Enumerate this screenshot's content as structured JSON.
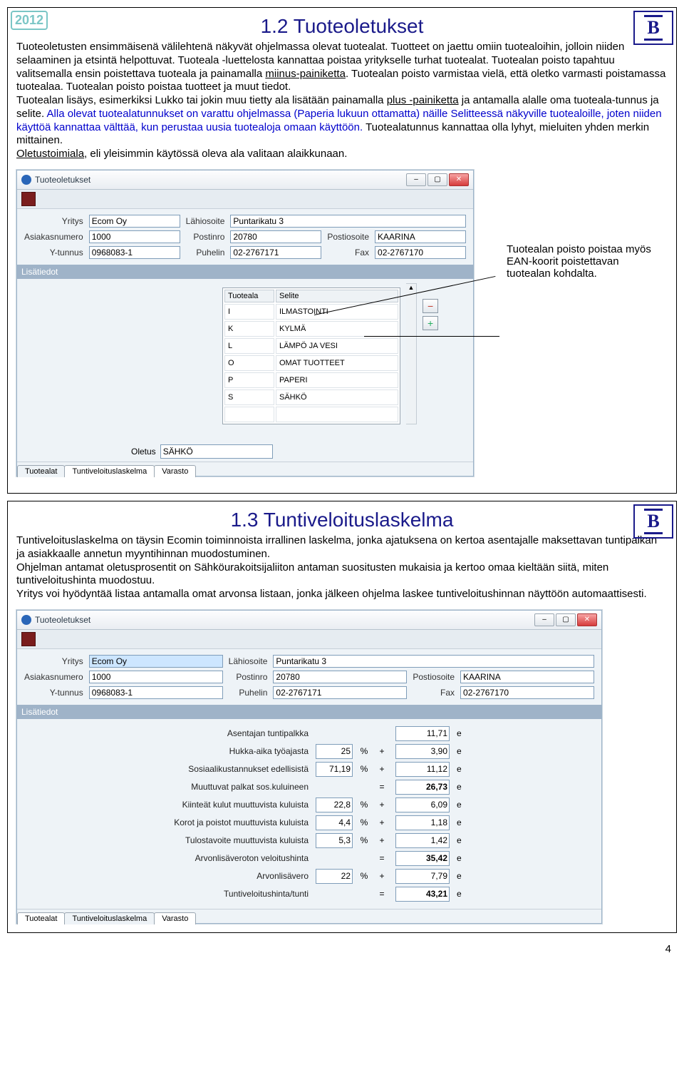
{
  "page_number": "4",
  "year_badge": "2012",
  "b_badge": "B",
  "slide1": {
    "title": "1.2 Tuoteoletukset",
    "para": "Tuoteoletusten ensimmäisenä välilehtenä näkyvät ohjelmassa olevat tuotealat. Tuotteet on jaettu omiin tuotealoihin, jolloin niiden selaaminen ja etsintä helpottuvat. Tuoteala -luettelosta kannattaa poistaa yritykselle turhat tuotealat. Tuotealan poisto tapahtuu valitsemalla ensin poistettava tuoteala ja painamalla ",
    "para_u1": "miinus-painiketta",
    "para2": ". Tuotealan poisto varmistaa vielä, että oletko varmasti poistamassa tuotealaa. Tuotealan poisto poistaa tuotteet ja muut tiedot.",
    "para3a": "Tuotealan lisäys, esimerkiksi Lukko tai jokin muu tietty ala lisätään painamalla ",
    "para3_u": "plus -painiketta",
    "para3b": " ja antamalla alalle oma tuoteala-tunnus ja selite. ",
    "para3_blue": "Alla olevat tuotealatunnukset on varattu ohjelmassa (Paperia lukuun ottamatta) näille Selitteessä näkyville tuotealoille, joten niiden käyttöä kannattaa välttää, kun perustaa uusia tuotealoja omaan käyttöön.",
    "para3c": " Tuotealatunnus kannattaa olla lyhyt, mieluiten yhden merkin mittainen.",
    "para4_u": "Oletustoimiala",
    "para4b": ", eli yleisimmin käytössä oleva ala valitaan alaikkunaan.",
    "callout": "Tuotealan poisto poistaa myös EAN-koorit poistettavan tuotealan kohdalta.",
    "win_title": "Tuoteoletukset",
    "form": {
      "l_yritys": "Yritys",
      "v_yritys": "Ecom Oy",
      "l_lahi": "Lähiosoite",
      "v_lahi": "Puntarikatu 3",
      "l_asnum": "Asiakasnumero",
      "v_asnum": "1000",
      "l_postinro": "Postinro",
      "v_postinro": "20780",
      "l_postios": "Postiosoite",
      "v_postios": "KAARINA",
      "l_yt": "Y-tunnus",
      "v_yt": "0968083-1",
      "l_puh": "Puhelin",
      "v_puh": "02-2767171",
      "l_fax": "Fax",
      "v_fax": "02-2767170"
    },
    "section": "Lisätiedot",
    "th1": "Tuoteala",
    "th2": "Selite",
    "rows": [
      {
        "a": "I",
        "b": "ILMASTOINTI"
      },
      {
        "a": "K",
        "b": "KYLMÄ"
      },
      {
        "a": "L",
        "b": "LÄMPÖ JA VESI"
      },
      {
        "a": "O",
        "b": "OMAT TUOTTEET"
      },
      {
        "a": "P",
        "b": "PAPERI"
      },
      {
        "a": "S",
        "b": "SÄHKÖ"
      }
    ],
    "btn_minus": "−",
    "btn_plus": "+",
    "oletus_lbl": "Oletus",
    "oletus_val": "SÄHKÖ",
    "tab1": "Tuotealat",
    "tab2": "Tuntiveloituslaskelma",
    "tab3": "Varasto"
  },
  "slide2": {
    "title": "1.3 Tuntiveloituslaskelma",
    "p1": "Tuntiveloituslaskelma on täysin Ecomin toiminnoista irrallinen laskelma, jonka ajatuksena on kertoa asentajalle maksettavan tuntipalkan ja asiakkaalle annetun myyntihinnan muodostuminen.",
    "p2": "Ohjelman antamat oletusprosentit on Sähköurakoitsijaliiton antaman suositusten mukaisia ja kertoo omaa kieltään siitä, miten tuntiveloitushinta muodostuu.",
    "p3": "Yritys voi hyödyntää listaa antamalla omat arvonsa listaan, jonka jälkeen ohjelma laskee tuntiveloitushinnan näyttöön automaattisesti.",
    "win_title": "Tuoteoletukset",
    "section": "Lisätiedot",
    "calc": [
      {
        "lbl": "Asentajan tuntipalkka",
        "pct": "",
        "op": "",
        "val": "11,71",
        "u": "e",
        "bold": false
      },
      {
        "lbl": "Hukka-aika työajasta",
        "pct": "25",
        "op": "+",
        "val": "3,90",
        "u": "e",
        "bold": false
      },
      {
        "lbl": "Sosiaalikustannukset edellisistä",
        "pct": "71,19",
        "op": "+",
        "val": "11,12",
        "u": "e",
        "bold": false
      },
      {
        "lbl": "Muuttuvat palkat sos.kuluineen",
        "pct": "",
        "op": "=",
        "val": "26,73",
        "u": "e",
        "bold": true
      },
      {
        "lbl": "Kiinteät kulut muuttuvista kuluista",
        "pct": "22,8",
        "op": "+",
        "val": "6,09",
        "u": "e",
        "bold": false
      },
      {
        "lbl": "Korot ja poistot muuttuvista kuluista",
        "pct": "4,4",
        "op": "+",
        "val": "1,18",
        "u": "e",
        "bold": false
      },
      {
        "lbl": "Tulostavoite muuttuvista kuluista",
        "pct": "5,3",
        "op": "+",
        "val": "1,42",
        "u": "e",
        "bold": false
      },
      {
        "lbl": "Arvonlisäveroton veloitushinta",
        "pct": "",
        "op": "=",
        "val": "35,42",
        "u": "e",
        "bold": true
      },
      {
        "lbl": "Arvonlisävero",
        "pct": "22",
        "op": "+",
        "val": "7,79",
        "u": "e",
        "bold": false
      },
      {
        "lbl": "Tuntiveloitushinta/tunti",
        "pct": "",
        "op": "=",
        "val": "43,21",
        "u": "e",
        "bold": true
      }
    ],
    "tab1": "Tuotealat",
    "tab2": "Tuntiveloituslaskelma",
    "tab3": "Varasto"
  }
}
